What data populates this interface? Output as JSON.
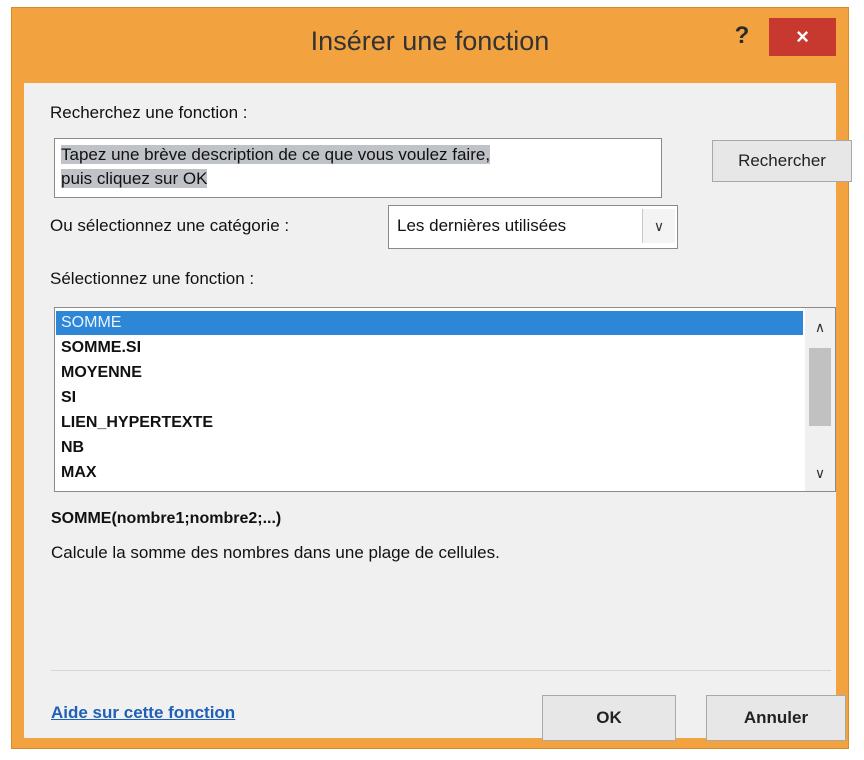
{
  "window": {
    "title": "Insérer une fonction",
    "help_label": "?",
    "close_label": "×",
    "accent_color": "#f2a340",
    "close_color": "#c7392e"
  },
  "search": {
    "label": "Recherchez une fonction :",
    "value_line1": "Tapez une brève description de ce que vous voulez faire,",
    "value_line2": "puis cliquez sur OK",
    "button_label": "Rechercher"
  },
  "category": {
    "label": "Ou sélectionnez une catégorie :",
    "selected": "Les dernières utilisées"
  },
  "functions": {
    "label": "Sélectionnez une fonction :",
    "items": [
      "SOMME",
      "SOMME.SI",
      "MOYENNE",
      "SI",
      "LIEN_HYPERTEXTE",
      "NB",
      "MAX"
    ],
    "selected_index": 0,
    "selection_color": "#2e86d6"
  },
  "details": {
    "syntax": "SOMME(nombre1;nombre2;...)",
    "description": "Calcule la somme des nombres dans une plage de cellules."
  },
  "footer": {
    "help_link": "Aide sur cette fonction",
    "ok_label": "OK",
    "cancel_label": "Annuler"
  }
}
